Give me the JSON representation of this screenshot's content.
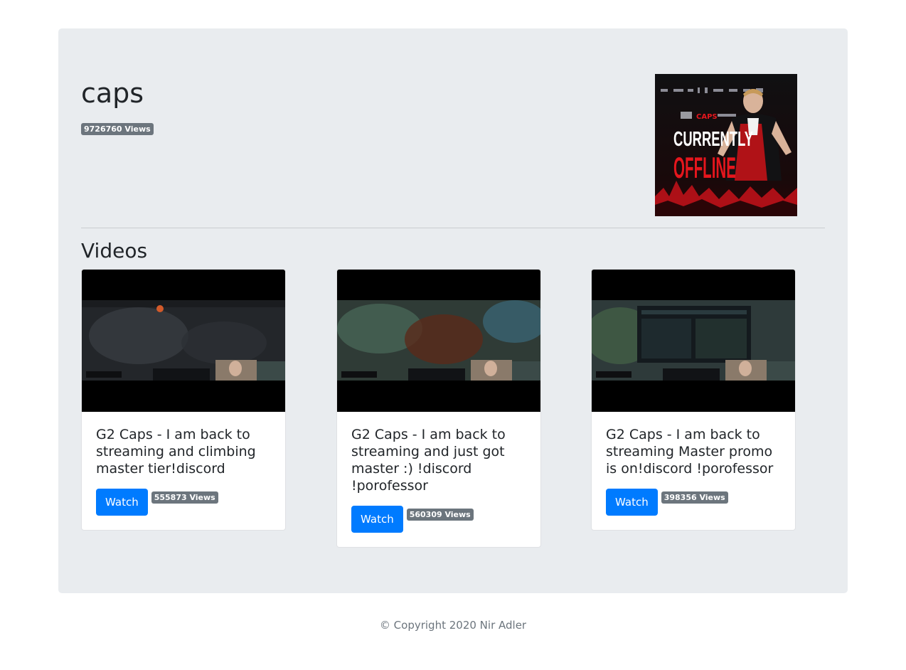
{
  "channel": {
    "name": "caps",
    "views_badge": "9726760 Views",
    "offline_image": {
      "line1": "CURRENTLY",
      "line2": "OFFLINE",
      "tag": "CAPS"
    }
  },
  "videos_section": {
    "title": "Videos"
  },
  "videos": [
    {
      "title": "G2 Caps - I am back to streaming and climbing master tier!discord",
      "watch_label": "Watch",
      "views_badge": "555873 Views"
    },
    {
      "title": "G2 Caps - I am back to streaming and just got master :) !discord !porofessor",
      "watch_label": "Watch",
      "views_badge": "560309 Views"
    },
    {
      "title": "G2 Caps - I am back to streaming Master promo is on!discord !porofessor",
      "watch_label": "Watch",
      "views_badge": "398356 Views"
    }
  ],
  "footer": {
    "text": "© Copyright 2020 Nir Adler"
  },
  "colors": {
    "jumbotron_bg": "#e9ecef",
    "primary": "#007bff",
    "badge_bg": "#6c757d",
    "offline_red": "#e5161d"
  }
}
